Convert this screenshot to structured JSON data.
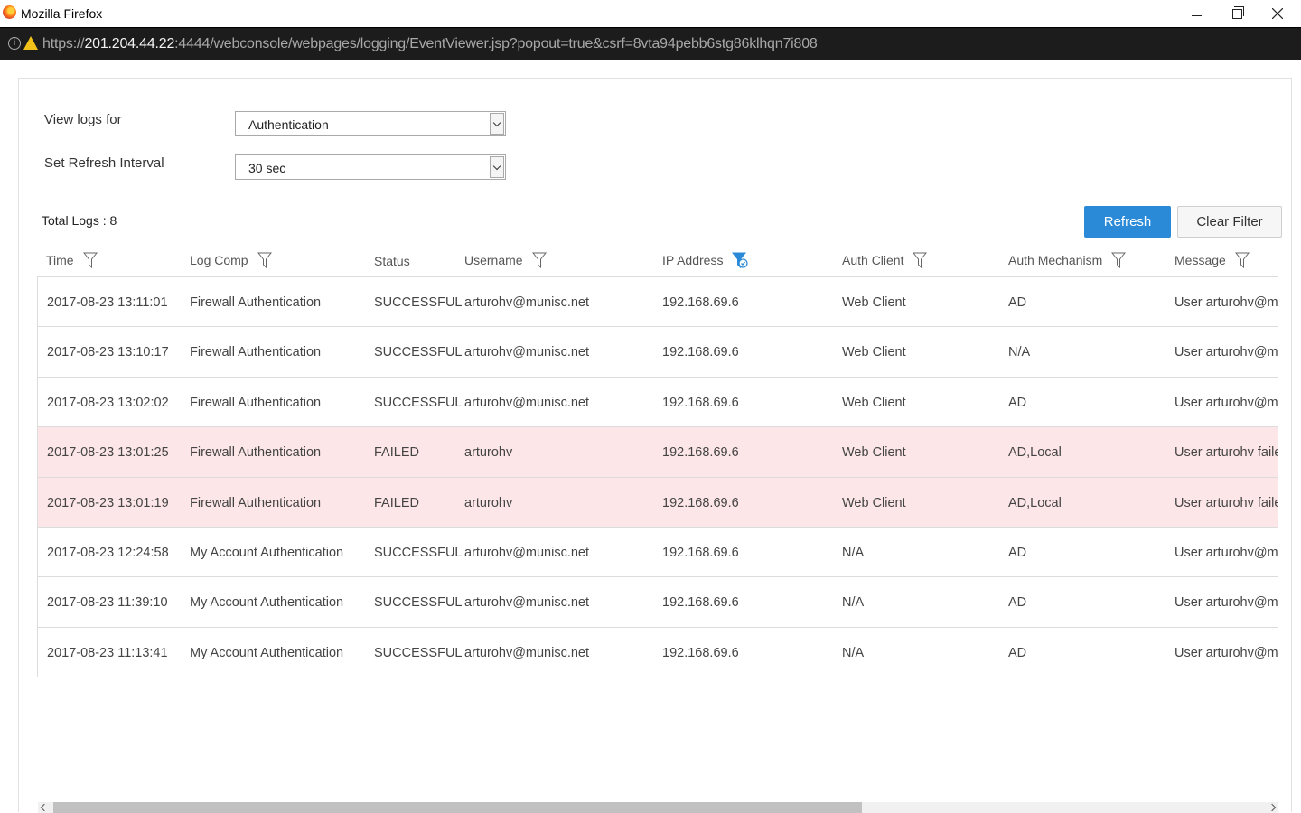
{
  "window": {
    "title": "Mozilla Firefox",
    "url_prefix": "https://",
    "url_host": "201.204.44.22",
    "url_rest": ":4444/webconsole/webpages/logging/EventViewer.jsp?popout=true&csrf=8vta94pebb6stg86klhqn7i808"
  },
  "filters": {
    "view_logs_label": "View logs for",
    "view_logs_value": "Authentication",
    "refresh_interval_label": "Set Refresh Interval",
    "refresh_interval_value": "30 sec"
  },
  "toolbar": {
    "total_logs": "Total Logs : 8",
    "refresh_label": "Refresh",
    "clear_filter_label": "Clear Filter"
  },
  "table": {
    "headers": {
      "time": "Time",
      "log_comp": "Log Comp",
      "status": "Status",
      "username": "Username",
      "ip_address": "IP Address",
      "auth_client": "Auth Client",
      "auth_mechanism": "Auth Mechanism",
      "message": "Message"
    },
    "rows": [
      {
        "time": "2017-08-23 13:11:01",
        "log_comp": "Firewall Authentication",
        "status": "SUCCESSFUL",
        "username": "arturohv@munisc.net",
        "ip": "192.168.69.6",
        "auth_client": "Web Client",
        "auth_mechanism": "AD",
        "message": "User arturohv@mu"
      },
      {
        "time": "2017-08-23 13:10:17",
        "log_comp": "Firewall Authentication",
        "status": "SUCCESSFUL",
        "username": "arturohv@munisc.net",
        "ip": "192.168.69.6",
        "auth_client": "Web Client",
        "auth_mechanism": "N/A",
        "message": "User arturohv@mu"
      },
      {
        "time": "2017-08-23 13:02:02",
        "log_comp": "Firewall Authentication",
        "status": "SUCCESSFUL",
        "username": "arturohv@munisc.net",
        "ip": "192.168.69.6",
        "auth_client": "Web Client",
        "auth_mechanism": "AD",
        "message": "User arturohv@mu"
      },
      {
        "time": "2017-08-23 13:01:25",
        "log_comp": "Firewall Authentication",
        "status": "FAILED",
        "username": "arturohv",
        "ip": "192.168.69.6",
        "auth_client": "Web Client",
        "auth_mechanism": "AD,Local",
        "message": "User arturohv failed"
      },
      {
        "time": "2017-08-23 13:01:19",
        "log_comp": "Firewall Authentication",
        "status": "FAILED",
        "username": "arturohv",
        "ip": "192.168.69.6",
        "auth_client": "Web Client",
        "auth_mechanism": "AD,Local",
        "message": "User arturohv failed"
      },
      {
        "time": "2017-08-23 12:24:58",
        "log_comp": "My Account Authentication",
        "status": "SUCCESSFUL",
        "username": "arturohv@munisc.net",
        "ip": "192.168.69.6",
        "auth_client": "N/A",
        "auth_mechanism": "AD",
        "message": "User arturohv@mu"
      },
      {
        "time": "2017-08-23 11:39:10",
        "log_comp": "My Account Authentication",
        "status": "SUCCESSFUL",
        "username": "arturohv@munisc.net",
        "ip": "192.168.69.6",
        "auth_client": "N/A",
        "auth_mechanism": "AD",
        "message": "User arturohv@mu"
      },
      {
        "time": "2017-08-23 11:13:41",
        "log_comp": "My Account Authentication",
        "status": "SUCCESSFUL",
        "username": "arturohv@munisc.net",
        "ip": "192.168.69.6",
        "auth_client": "N/A",
        "auth_mechanism": "AD",
        "message": "User arturohv@mu"
      }
    ]
  },
  "colors": {
    "accent": "#2b8ad8",
    "failed_row": "#fde6e7",
    "active_filter": "#2b8ad8"
  },
  "icons": {
    "filter": "filter-funnel-icon",
    "active_filter": "filter-active-icon"
  }
}
